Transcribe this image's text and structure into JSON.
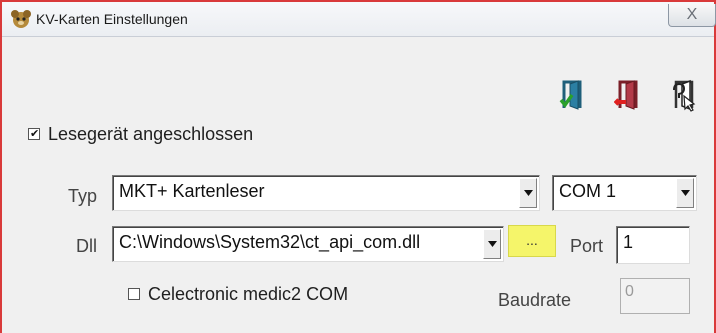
{
  "window": {
    "title": "KV-Karten Einstellungen",
    "close_symbol": "X"
  },
  "toolbar": {
    "icons": [
      "exit-confirm-icon",
      "exit-cancel-icon",
      "exit-help-icon"
    ]
  },
  "reader_connected": {
    "label": "Lesegerät angeschlossen",
    "checked": true
  },
  "typ": {
    "label": "Typ",
    "value": "MKT+ Kartenleser",
    "com_value": "COM 1"
  },
  "dll": {
    "label": "Dll",
    "value": "C:\\Windows\\System32\\ct_api_com.dll",
    "browse_label": "..."
  },
  "port": {
    "label": "Port",
    "value": "1"
  },
  "celectronic": {
    "label": "Celectronic medic2 COM",
    "checked": false
  },
  "baudrate": {
    "label": "Baudrate",
    "value": "0"
  },
  "colors": {
    "frame": "#d93a3a",
    "highlight": "#f5f56a"
  }
}
